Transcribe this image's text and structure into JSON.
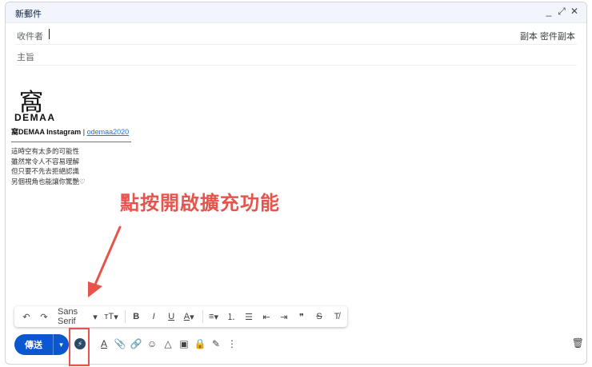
{
  "window": {
    "title": "新郵件",
    "controls": [
      "_",
      "⤢",
      "✕"
    ]
  },
  "compose": {
    "to_label": "收件者",
    "cc_label": "副本",
    "bcc_label": "密件副本",
    "subject_placeholder": "主旨"
  },
  "signature": {
    "logo_glyph": "窩",
    "logo_text": "DEMAA",
    "name": "窩DEMAA Instagram",
    "separator": "|",
    "link": "odemaa2020",
    "poem": [
      "這時空有太多的可能性",
      "雖然常令人不容易理解",
      "但只要不先去拒絕認識",
      "另個視角也能讓你驚艷♡"
    ]
  },
  "annotation": {
    "text": "點按開啟擴充功能",
    "color": "#e5554e"
  },
  "format_toolbar": {
    "undo": "↶",
    "redo": "↷",
    "font": "Sans Serif",
    "font_dropdown": "▾",
    "size": "тT",
    "size_dropdown": "▾",
    "bold": "B",
    "italic": "I",
    "underline": "U",
    "text_color": "A",
    "color_dropdown": "▾",
    "align": "≡",
    "align_dropdown": "▾",
    "numbered_list": "⒈",
    "bulleted_list": "☰",
    "indent_less": "⇤",
    "indent_more": "⇥",
    "quote": "❞",
    "strikethrough": "S",
    "clear_format": "T̸"
  },
  "bottom_bar": {
    "send_label": "傳送",
    "send_dropdown": "▾",
    "extension_glyph": "⚡",
    "tools": [
      "A",
      "📎",
      "🔗",
      "☺",
      "△",
      "▣",
      "🔒",
      "✎",
      "⋮"
    ],
    "trash": "🗑"
  },
  "colors": {
    "accent": "#0b57d0",
    "annotation_red": "#e5554e",
    "titlebar_bg": "#f2f6fc"
  }
}
